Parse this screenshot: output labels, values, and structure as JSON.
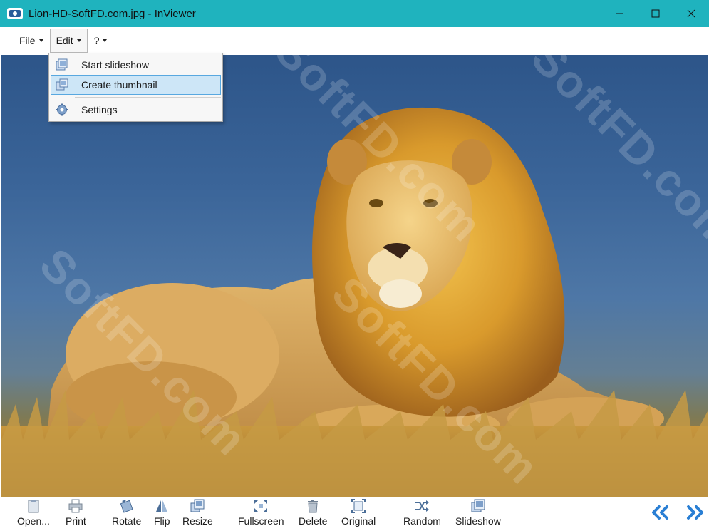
{
  "window": {
    "title": "Lion-HD-SoftFD.com.jpg - InViewer"
  },
  "menu": {
    "file": "File",
    "edit": "Edit",
    "help": "?"
  },
  "edit_menu": {
    "items": [
      {
        "label": "Start slideshow",
        "icon": "slideshow-icon"
      },
      {
        "label": "Create thumbnail",
        "icon": "thumbnail-icon",
        "highlighted": true
      },
      {
        "label": "Settings",
        "icon": "gear-icon"
      }
    ]
  },
  "viewer": {
    "watermark": "SoftFD.com"
  },
  "toolbar": {
    "buttons": [
      {
        "label": "Open...",
        "icon": "open-icon"
      },
      {
        "label": "Print",
        "icon": "print-icon"
      },
      {
        "label": "Rotate",
        "icon": "rotate-icon"
      },
      {
        "label": "Flip",
        "icon": "flip-icon"
      },
      {
        "label": "Resize",
        "icon": "resize-icon"
      },
      {
        "label": "Fullscreen",
        "icon": "fullscreen-icon"
      },
      {
        "label": "Delete",
        "icon": "trash-icon"
      },
      {
        "label": "Original",
        "icon": "original-size-icon"
      },
      {
        "label": "Random",
        "icon": "shuffle-icon"
      },
      {
        "label": "Slideshow",
        "icon": "slideshow-icon"
      }
    ],
    "nav": [
      "previous-icon",
      "next-icon"
    ]
  },
  "colors": {
    "titlebar": "#1fb3be",
    "accent": "#2a7fd4",
    "menu_highlight": "#cde6f7"
  }
}
